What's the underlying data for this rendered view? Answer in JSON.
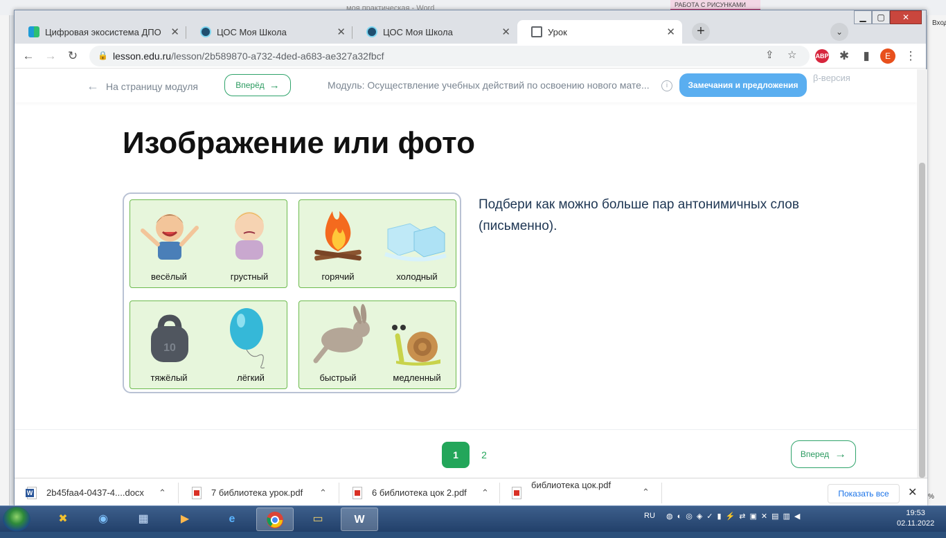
{
  "background_window": {
    "title": "моя практическая - Word",
    "ribbon_tab": "РАБОТА С РИСУНКАМИ",
    "signin": "Вход",
    "zoom_pct": "%"
  },
  "browser": {
    "tabs": [
      {
        "title": "Цифровая экосистема ДПО",
        "active": false
      },
      {
        "title": "ЦОС Моя Школа",
        "active": false
      },
      {
        "title": "ЦОС Моя Школа",
        "active": false
      },
      {
        "title": "Урок",
        "active": true
      }
    ],
    "url_host": "lesson.edu.ru",
    "url_path": "/lesson/2b589870-a732-4ded-a683-ae327a32fbcf",
    "avatar_letter": "E",
    "ext_abp": "ABP"
  },
  "lesson_header": {
    "back_label": "На страницу модуля",
    "forward_label": "Вперёд",
    "module_title": "Модуль: Осуществление учебных действий по освоению нового мате...",
    "feedback_label": "Замечания и предложения",
    "beta_label": "β-версия"
  },
  "content": {
    "title": "Изображение или фото",
    "task_text": "Подбери как можно больше пар антонимичных слов (письменно).",
    "image_pairs": [
      {
        "left": "весёлый",
        "right": "грустный"
      },
      {
        "left": "горячий",
        "right": "холодный"
      },
      {
        "left": "тяжёлый",
        "right": "лёгкий"
      },
      {
        "left": "быстрый",
        "right": "медленный"
      }
    ],
    "weight_mark": "10"
  },
  "pagination": {
    "pages": [
      "1",
      "2"
    ],
    "current": "1",
    "next_label": "Вперед"
  },
  "downloads": {
    "items": [
      {
        "name": "2b45faa4-0437-4....docx",
        "type": "doc"
      },
      {
        "name": "7 библиотека урок.pdf",
        "type": "pdf"
      },
      {
        "name": "6 библиотека цок 2.pdf",
        "type": "pdf"
      },
      {
        "name": "библиотека цок.pdf",
        "type": "pdf"
      }
    ],
    "show_all": "Показать все"
  },
  "taskbar": {
    "lang": "RU",
    "time": "19:53",
    "date": "02.11.2022"
  }
}
